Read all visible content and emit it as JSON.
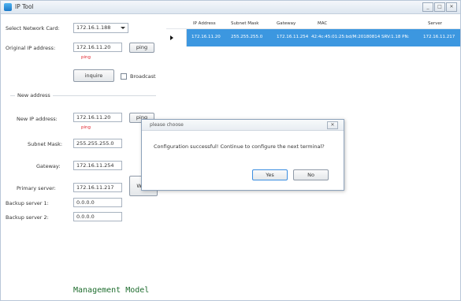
{
  "app": {
    "title": "IP Tool"
  },
  "window_buttons": {
    "minimize": "_",
    "restore": "□",
    "close": "✕"
  },
  "left": {
    "select_card_label": "Select Network Card:",
    "select_card_value": "172.16.1.188",
    "original_ip_label": "Original IP address:",
    "original_ip_value": "172.16.11.20",
    "ping_label": "ping",
    "ping_status_1": "ping",
    "inquire_label": "inquire",
    "broadcast_label": "Broadcast",
    "group_title": "New address",
    "new_ip_label": "New IP address:",
    "new_ip_value": "172.16.11.20",
    "ping_label_2": "ping",
    "ping_status_2": "ping",
    "subnet_label": "Subnet Mask:",
    "subnet_value": "255.255.255.0",
    "gateway_label": "Gateway:",
    "gateway_value": "172.16.11.254",
    "primary_label": "Primary server:",
    "primary_value": "172.16.11.217",
    "write_label": "Write",
    "backup1_label": "Backup server 1:",
    "backup1_value": "0.0.0.0",
    "backup2_label": "Backup server 2:",
    "backup2_value": "0.0.0.0"
  },
  "grid": {
    "headers": [
      "IP Address",
      "Subnet Mask",
      "Gateway",
      "MAC",
      "Server"
    ],
    "row": [
      "172.16.11.20",
      "255.255.255.0",
      "172.16.11.254",
      "42:4c:45:01:25:bd/M:20180814 SRV:1.18 PN:",
      "172.16.11.217"
    ]
  },
  "dialog": {
    "title": "please choose",
    "close": "✕",
    "message": "Configuration successful! Continue to configure the next terminal?",
    "yes": "Yes",
    "no": "No"
  },
  "footer": {
    "text": "Management Model"
  },
  "colors": {
    "accent": "#3c97e0",
    "error_text": "#e0202a",
    "footer_text": "#1f6d2f"
  }
}
